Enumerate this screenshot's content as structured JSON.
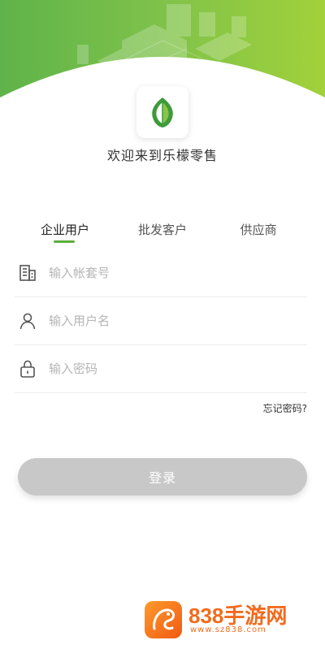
{
  "header": {
    "welcome_text": "欢迎来到乐檬零售",
    "brand_color": "#5aae3a",
    "logo_icon": "leaf-logo-icon",
    "banner_image": "city-isometric-illustration"
  },
  "tabs": [
    {
      "label": "企业用户",
      "active": true
    },
    {
      "label": "批发客户",
      "active": false
    },
    {
      "label": "供应商",
      "active": false
    }
  ],
  "form": {
    "account_no": {
      "placeholder": "输入帐套号",
      "value": "",
      "icon": "building-icon"
    },
    "username": {
      "placeholder": "输入用户名",
      "value": "",
      "icon": "user-icon"
    },
    "password": {
      "placeholder": "输入密码",
      "value": "",
      "icon": "lock-icon"
    },
    "forgot_label": "忘记密码?",
    "login_label": "登录",
    "login_button_color": "#c8c8c8"
  },
  "watermark": {
    "title": "838手游网",
    "url": "www.sz838.com",
    "color": "#f26b1d"
  }
}
